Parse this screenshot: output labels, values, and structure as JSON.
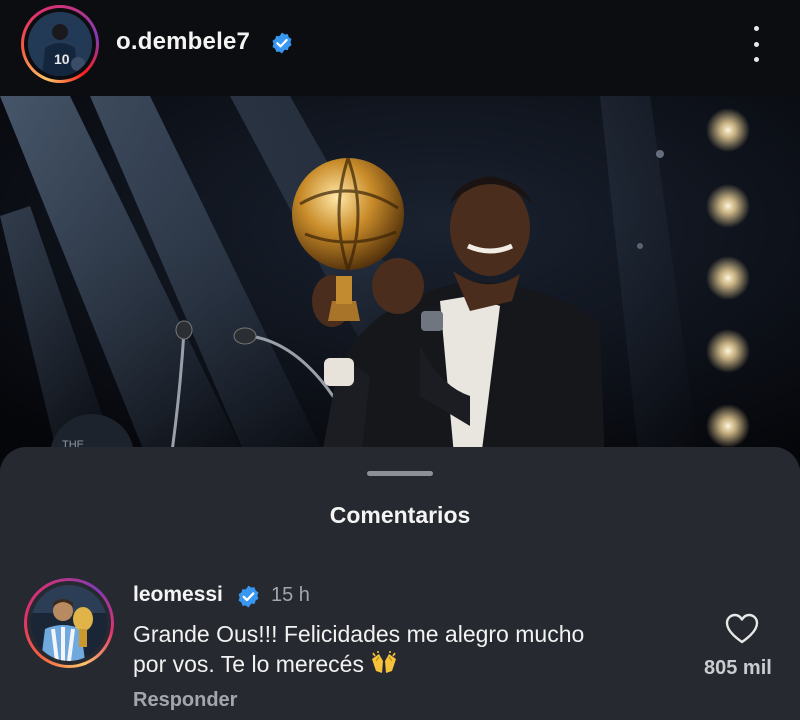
{
  "post": {
    "username": "o.dembele7",
    "verified": true,
    "menu_icon": "more-vertical-icon"
  },
  "comments_sheet": {
    "title": "Comentarios",
    "comments": [
      {
        "username": "leomessi",
        "verified": true,
        "time": "15 h",
        "text_line1": "Grande Ous!!! Felicidades me alegro mucho",
        "text_line2": "por vos. Te lo merecés",
        "emoji": "raising-hands-emoji",
        "reply_label": "Responder",
        "likes": "805 mil",
        "like_icon": "heart-outline-icon"
      }
    ]
  },
  "colors": {
    "background": "#0f1013",
    "sheet": "#26292f",
    "verified": "#3897f0",
    "secondary_text": "#a3a6ac",
    "story_ring": [
      "#fdc468",
      "#e1306c",
      "#833ab4"
    ]
  }
}
